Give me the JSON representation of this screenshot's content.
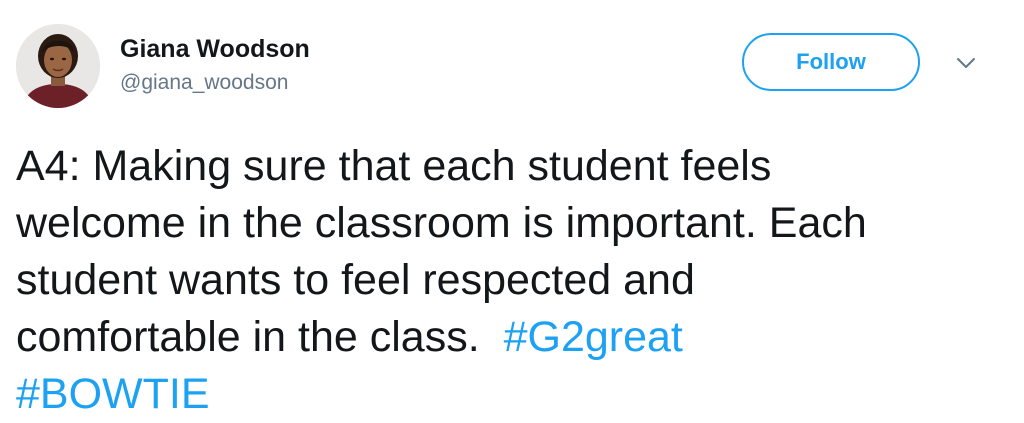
{
  "author": {
    "display_name": "Giana Woodson",
    "handle": "@giana_woodson"
  },
  "follow_button": {
    "label": "Follow"
  },
  "tweet": {
    "lines": [
      "A4: Making sure that each student feels",
      "welcome in the classroom is important. Each",
      "student wants to feel respected and",
      "comfortable in the class."
    ],
    "hashtags": [
      "#G2great",
      "#BOWTIE"
    ]
  },
  "icons": {
    "avatar": "user-avatar-photo",
    "menu": "chevron-down-icon"
  },
  "colors": {
    "accent": "#1da1f2",
    "text": "#14171a",
    "secondary_text": "#657786"
  }
}
